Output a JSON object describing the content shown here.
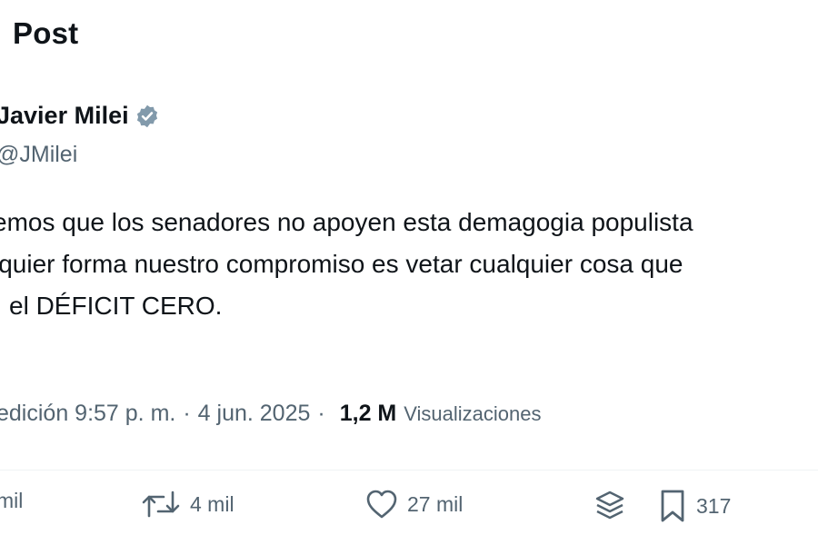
{
  "header": {
    "title": "Post"
  },
  "author": {
    "name": "Javier Milei",
    "handle": "@JMilei",
    "verified_color": "#829aab"
  },
  "post": {
    "lines": [
      "emos que los senadores no apoyen esta demagogia populista",
      "lquier forma nuestro compromiso es vetar cualquier cosa que",
      "el DÉFICIT CERO."
    ]
  },
  "meta": {
    "edit_time": "edición 9:57 p. m.",
    "date": "4 jun. 2025",
    "separator": "·",
    "views_count": "1,2 M",
    "views_label": "Visualizaciones"
  },
  "actions": {
    "replies": "mil",
    "reposts": "4 mil",
    "likes": "27 mil",
    "bookmarks": "317"
  },
  "icons": [
    "verified-badge-icon",
    "repost-icon",
    "heart-icon",
    "stack-icon",
    "bookmark-icon"
  ]
}
